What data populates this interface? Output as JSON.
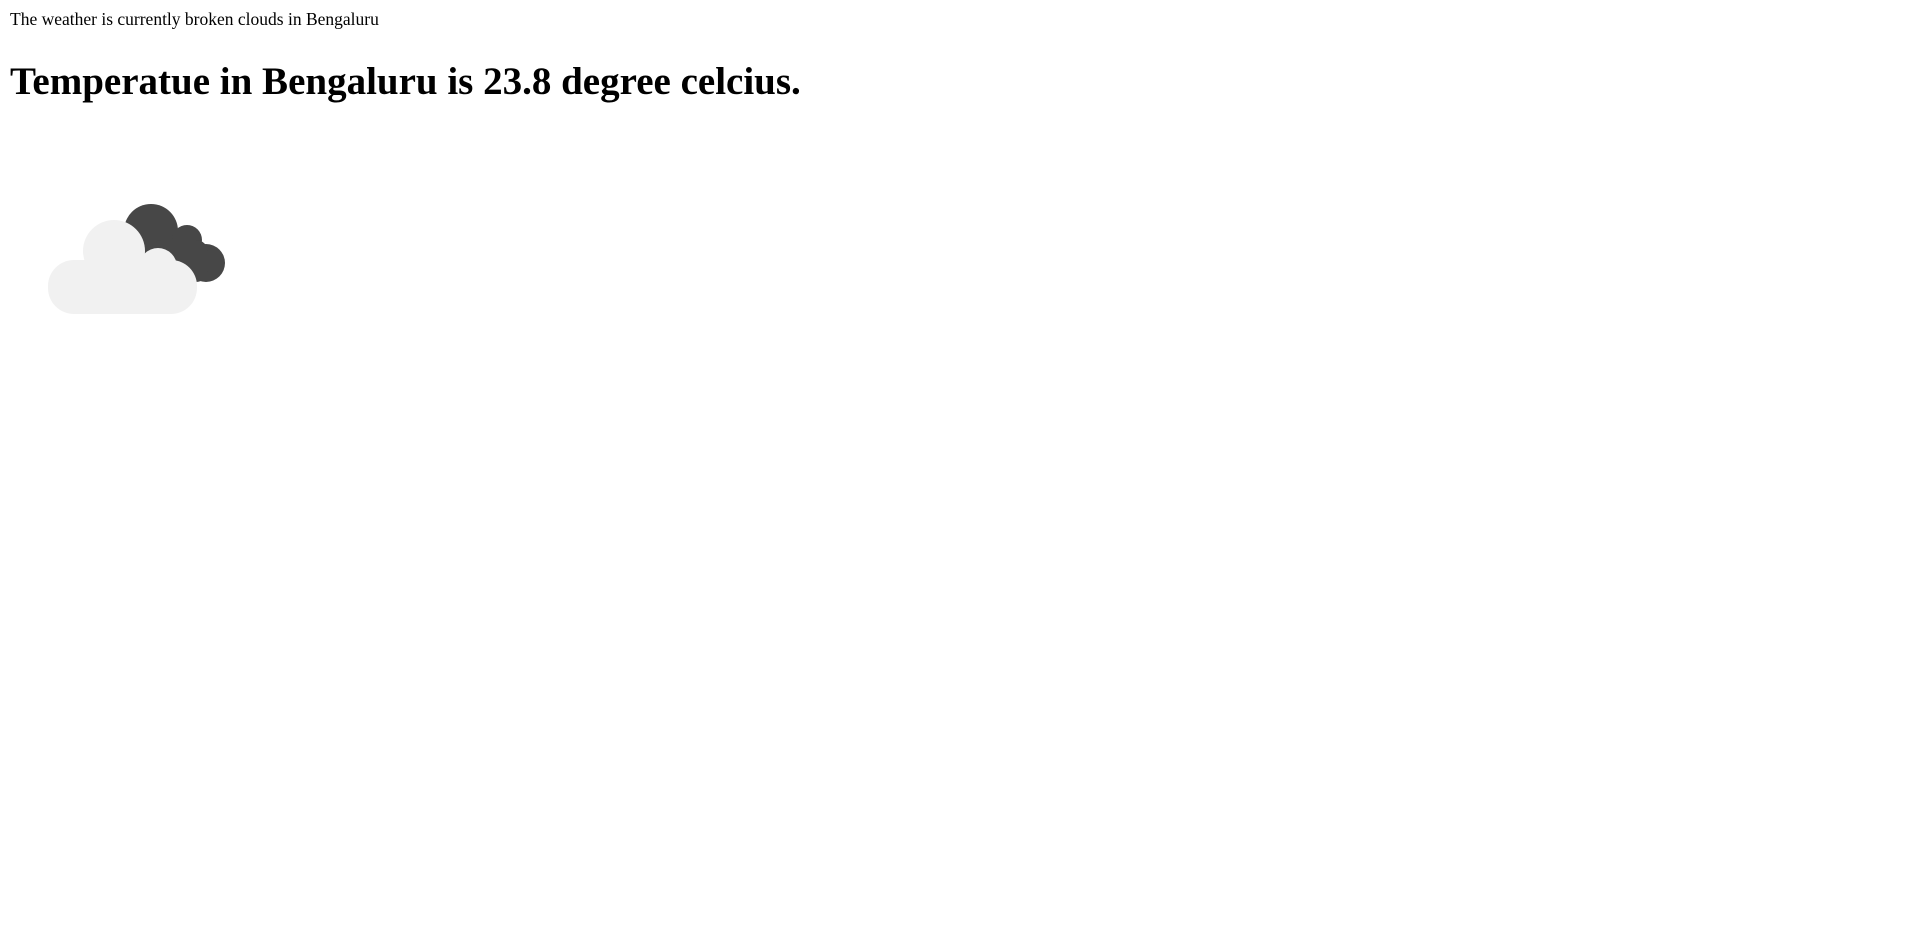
{
  "weather": {
    "description_text": "The weather is currently broken clouds in Bengaluru",
    "temperature_text": "Temperatue in Bengaluru is 23.8 degree celcius.",
    "icon": "broken-clouds-icon",
    "colors": {
      "front_cloud": "#f1f1f1",
      "back_cloud": "#474747"
    }
  }
}
